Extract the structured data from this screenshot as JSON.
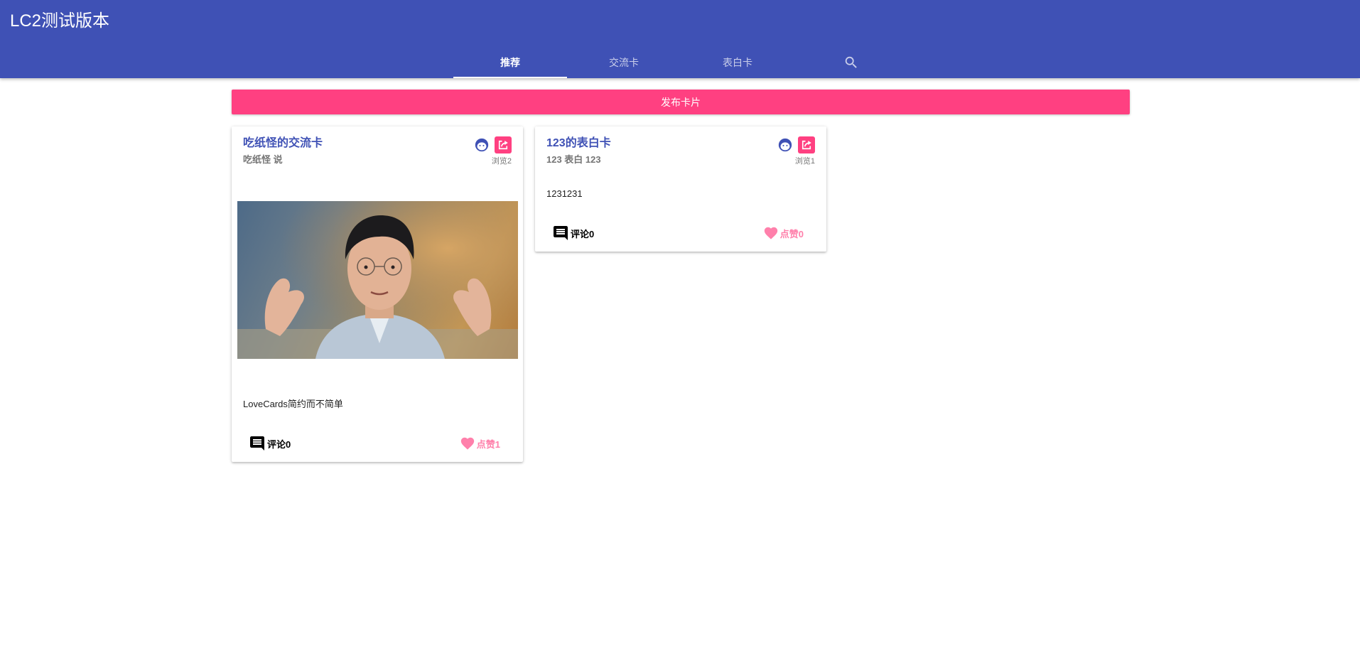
{
  "app": {
    "title": "LC2测试版本"
  },
  "tabs": [
    {
      "label": "推荐",
      "active": true
    },
    {
      "label": "交流卡",
      "active": false
    },
    {
      "label": "表白卡",
      "active": false
    }
  ],
  "search_icon": "search-icon",
  "publish_button": {
    "label": "发布卡片"
  },
  "colors": {
    "primary": "#3f51b5",
    "accent": "#ff4081",
    "like": "#ff80ab"
  },
  "cards": [
    {
      "title": "吃纸怪的交流卡",
      "subtitle": "吃纸怪 说",
      "views": "浏览2",
      "text": "LoveCards简约而不简单",
      "comment_label": "评论0",
      "like_label": "点赞1",
      "has_image": true
    },
    {
      "title": "123的表白卡",
      "subtitle": "123 表白 123",
      "views": "浏览1",
      "text": "1231231",
      "comment_label": "评论0",
      "like_label": "点赞0",
      "has_image": false
    }
  ]
}
